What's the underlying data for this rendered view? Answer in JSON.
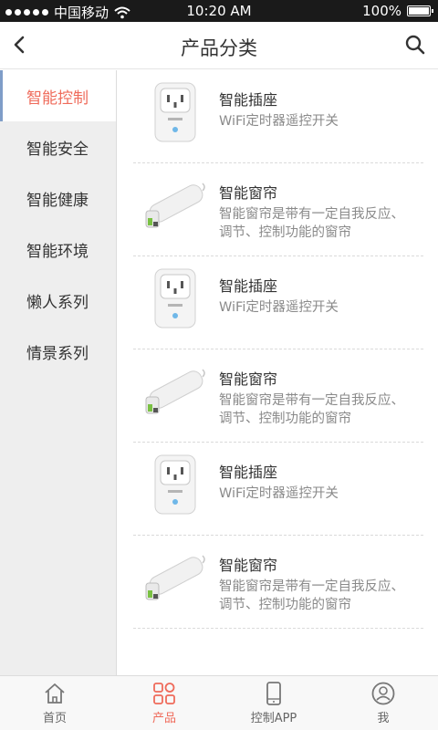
{
  "status_bar": {
    "carrier": "中国移动",
    "time": "10:20 AM",
    "battery": "100%"
  },
  "header": {
    "title": "产品分类"
  },
  "sidebar": {
    "items": [
      {
        "label": "智能控制",
        "active": true
      },
      {
        "label": "智能安全",
        "active": false
      },
      {
        "label": "智能健康",
        "active": false
      },
      {
        "label": "智能环境",
        "active": false
      },
      {
        "label": "懒人系列",
        "active": false
      },
      {
        "label": "情景系列",
        "active": false
      }
    ]
  },
  "products": [
    {
      "type": "socket",
      "title": "智能插座",
      "desc": "WiFi定时器遥控开关"
    },
    {
      "type": "curtain",
      "title": "智能窗帘",
      "desc": "智能窗帘是带有一定自我反应、调节、控制功能的窗帘"
    },
    {
      "type": "socket",
      "title": "智能插座",
      "desc": "WiFi定时器遥控开关"
    },
    {
      "type": "curtain",
      "title": "智能窗帘",
      "desc": "智能窗帘是带有一定自我反应、调节、控制功能的窗帘"
    },
    {
      "type": "socket",
      "title": "智能插座",
      "desc": "WiFi定时器遥控开关"
    },
    {
      "type": "curtain",
      "title": "智能窗帘",
      "desc": "智能窗帘是带有一定自我反应、调节、控制功能的窗帘"
    }
  ],
  "tabbar": {
    "items": [
      {
        "label": "首页",
        "icon": "home-icon",
        "active": false
      },
      {
        "label": "产品",
        "icon": "grid-icon",
        "active": true
      },
      {
        "label": "控制APP",
        "icon": "phone-icon",
        "active": false
      },
      {
        "label": "我",
        "icon": "user-icon",
        "active": false
      }
    ]
  },
  "colors": {
    "accent": "#ef6b5b",
    "sidebar_bg": "#eeeeee",
    "active_indicator": "#7f9dc8"
  }
}
